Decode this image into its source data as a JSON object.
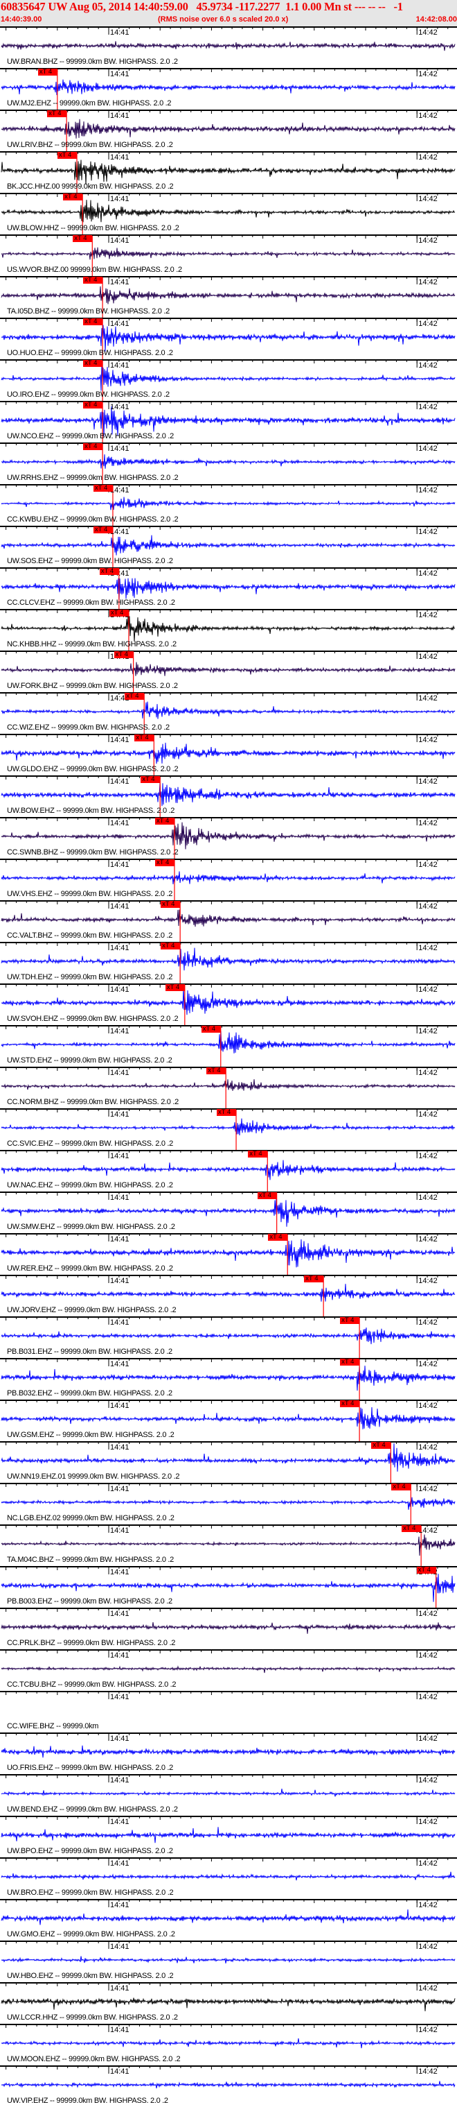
{
  "header": {
    "title": "60835647 UW Aug 05, 2014 14:40:59.00   45.9734 -117.2277  1.1 0.00 Mn st --- -- --   -1",
    "start_time": "14:40:39.00",
    "note": "(RMS noise over 6.0 s scaled 20.0 x)",
    "end_time": "14:42:08.00"
  },
  "time_axis": {
    "start_seconds_after": "14:40:39",
    "duration_s": 89,
    "tick_labels": [
      {
        "text": "14:41",
        "t": 21
      },
      {
        "text": "14:42",
        "t": 81
      }
    ]
  },
  "pick_label": "xT 4",
  "colors": {
    "purple": "#22004e",
    "blue": "#0000ff",
    "black": "#000000",
    "pick": "#ff0000",
    "header_text": "#f00000",
    "header_bg": "#e6e6e6"
  },
  "traces": [
    {
      "label": "UW.BRAN.BHZ -- 99999.0km BW. HIGHPASS. 2.0 .2",
      "color": "purple",
      "pick_t": null
    },
    {
      "label": "UW.MJ2.EHZ -- 99999.0km BW. HIGHPASS. 2.0 .2",
      "color": "blue",
      "pick_t": 11.0
    },
    {
      "label": "UW.LRIV.BHZ -- 99999.0km BW. HIGHPASS. 2.0 .2",
      "color": "purple",
      "pick_t": 12.8
    },
    {
      "label": "BK.JCC.HHZ.00 99999.0km BW. HIGHPASS. 2.0 .2",
      "color": "black",
      "pick_t": 14.8
    },
    {
      "label": "UW.BLOW.HHZ -- 99999.0km BW. HIGHPASS. 2.0 .2",
      "color": "black",
      "pick_t": 15.9
    },
    {
      "label": "US.WVOR.BHZ.00 99999.0km BW. HIGHPASS. 2.0 .2",
      "color": "purple",
      "pick_t": 17.8
    },
    {
      "label": "TA.I05D.BHZ -- 99999.0km BW. HIGHPASS. 2.0 .2",
      "color": "purple",
      "pick_t": 19.8
    },
    {
      "label": "UO.HUO.EHZ -- 99999.0km BW. HIGHPASS. 2.0 .2",
      "color": "blue",
      "pick_t": 19.8
    },
    {
      "label": "UO.IRO.EHZ -- 99999.0km BW. HIGHPASS. 2.0 .2",
      "color": "blue",
      "pick_t": 19.8
    },
    {
      "label": "UW.NCO.EHZ -- 99999.0km BW. HIGHPASS. 2.0 .2",
      "color": "blue",
      "pick_t": 19.8
    },
    {
      "label": "UW.RRHS.EHZ -- 99999.0km BW. HIGHPASS. 2.0 .2",
      "color": "blue",
      "pick_t": 19.8
    },
    {
      "label": "CC.KWBU.EHZ -- 99999.0km BW. HIGHPASS. 2.0 .2",
      "color": "blue",
      "pick_t": 21.8
    },
    {
      "label": "UW.SOS.EHZ -- 99999.0km BW. HIGHPASS. 2.0 .2",
      "color": "blue",
      "pick_t": 21.8
    },
    {
      "label": "CC.CLCV.EHZ -- 99999.0km BW. HIGHPASS. 2.0 .2",
      "color": "blue",
      "pick_t": 23.0
    },
    {
      "label": "NC.KHBB.HHZ -- 99999.0km BW. HIGHPASS. 2.0 .2",
      "color": "black",
      "pick_t": 24.9
    },
    {
      "label": "UW.FORK.BHZ -- 99999.0km BW. HIGHPASS. 2.0 .2",
      "color": "purple",
      "pick_t": 25.8
    },
    {
      "label": "CC.WIZ.EHZ -- 99999.0km BW. HIGHPASS. 2.0 .2",
      "color": "blue",
      "pick_t": 27.9
    },
    {
      "label": "UW.GLDO.EHZ -- 99999.0km BW. HIGHPASS. 2.0 .2",
      "color": "blue",
      "pick_t": 29.8
    },
    {
      "label": "UW.BOW.EHZ -- 99999.0km BW. HIGHPASS. 2.0 .2",
      "color": "blue",
      "pick_t": 31.0
    },
    {
      "label": "CC.SWNB.BHZ -- 99999.0km BW. HIGHPASS. 2.0 .2",
      "color": "purple",
      "pick_t": 33.8
    },
    {
      "label": "UW.VHS.EHZ -- 99999.0km BW. HIGHPASS. 2.0 .2",
      "color": "blue",
      "pick_t": 33.8
    },
    {
      "label": "CC.VALT.BHZ -- 99999.0km BW. HIGHPASS. 2.0 .2",
      "color": "purple",
      "pick_t": 34.9
    },
    {
      "label": "UW.TDH.EHZ -- 99999.0km BW. HIGHPASS. 2.0 .2",
      "color": "blue",
      "pick_t": 34.9
    },
    {
      "label": "UW.SVOH.EHZ -- 99999.0km BW. HIGHPASS. 2.0 .2",
      "color": "blue",
      "pick_t": 35.8
    },
    {
      "label": "UW.STD.EHZ -- 99999.0km BW. HIGHPASS. 2.0 .2",
      "color": "blue",
      "pick_t": 42.8
    },
    {
      "label": "CC.NORM.BHZ -- 99999.0km BW. HIGHPASS. 2.0 .2",
      "color": "purple",
      "pick_t": 43.8
    },
    {
      "label": "CC.SVIC.EHZ -- 99999.0km BW. HIGHPASS. 2.0 .2",
      "color": "blue",
      "pick_t": 45.8
    },
    {
      "label": "UW.NAC.EHZ -- 99999.0km BW. HIGHPASS. 2.0 .2",
      "color": "blue",
      "pick_t": 51.9
    },
    {
      "label": "UW.SMW.EHZ -- 99999.0km BW. HIGHPASS. 2.0 .2",
      "color": "blue",
      "pick_t": 53.7
    },
    {
      "label": "UW.RER.EHZ -- 99999.0km BW. HIGHPASS. 2.0 .2",
      "color": "blue",
      "pick_t": 55.8
    },
    {
      "label": "UW.JORV.EHZ -- 99999.0km BW. HIGHPASS. 2.0 .2",
      "color": "blue",
      "pick_t": 62.8
    },
    {
      "label": "PB.B031.EHZ -- 99999.0km BW. HIGHPASS. 2.0 .2",
      "color": "blue",
      "pick_t": 69.8
    },
    {
      "label": "PB.B032.EHZ -- 99999.0km BW. HIGHPASS. 2.0 .2",
      "color": "blue",
      "pick_t": 69.8
    },
    {
      "label": "UW.GSM.EHZ -- 99999.0km BW. HIGHPASS. 2.0 .2",
      "color": "blue",
      "pick_t": 69.8
    },
    {
      "label": "UW.NN19.EHZ.01 99999.0km BW. HIGHPASS. 2.0 .2",
      "color": "blue",
      "pick_t": 75.9
    },
    {
      "label": "NC.LGB.EHZ.02 99999.0km BW. HIGHPASS. 2.0 .2",
      "color": "blue",
      "pick_t": 79.8
    },
    {
      "label": "TA.M04C.BHZ -- 99999.0km BW. HIGHPASS. 2.0 .2",
      "color": "purple",
      "pick_t": 81.8
    },
    {
      "label": "PB.B003.EHZ -- 99999.0km BW. HIGHPASS. 2.0 .2",
      "color": "blue",
      "pick_t": 84.7
    },
    {
      "label": "CC.PRLK.BHZ -- 99999.0km BW. HIGHPASS. 2.0 .2",
      "color": "purple",
      "pick_t": null
    },
    {
      "label": "CC.TCBU.BHZ -- 99999.0km BW. HIGHPASS. 2.0 .2",
      "color": "purple",
      "pick_t": null
    },
    {
      "label": "CC.WIFE.BHZ -- 99999.0km",
      "color": "none",
      "pick_t": null
    },
    {
      "label": "UO.FRIS.EHZ -- 99999.0km BW. HIGHPASS. 2.0 .2",
      "color": "blue",
      "pick_t": null
    },
    {
      "label": "UW.BEND.EHZ -- 99999.0km BW. HIGHPASS. 2.0 .2",
      "color": "blue",
      "pick_t": null
    },
    {
      "label": "UW.BPO.EHZ -- 99999.0km BW. HIGHPASS. 2.0 .2",
      "color": "blue",
      "pick_t": null
    },
    {
      "label": "UW.BRO.EHZ -- 99999.0km BW. HIGHPASS. 2.0 .2",
      "color": "blue",
      "pick_t": null
    },
    {
      "label": "UW.GMO.EHZ -- 99999.0km BW. HIGHPASS. 2.0 .2",
      "color": "blue",
      "pick_t": null
    },
    {
      "label": "UW.HBO.EHZ -- 99999.0km BW. HIGHPASS. 2.0 .2",
      "color": "blue",
      "pick_t": null
    },
    {
      "label": "UW.LCCR.HHZ -- 99999.0km BW. HIGHPASS. 2.0 .2",
      "color": "black",
      "pick_t": null
    },
    {
      "label": "UW.MOON.EHZ -- 99999.0km BW. HIGHPASS. 2.0 .2",
      "color": "blue",
      "pick_t": null
    },
    {
      "label": "UW.VIP.EHZ -- 99999.0km BW. HIGHPASS. 2.0 .2",
      "color": "blue",
      "pick_t": null
    }
  ]
}
